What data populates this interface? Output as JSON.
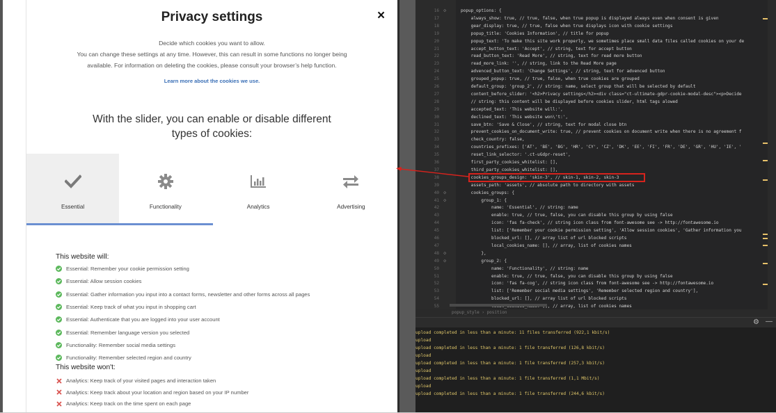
{
  "modal": {
    "title": "Privacy settings",
    "close_label": "×",
    "desc_line1": "Decide which cookies you want to allow.",
    "desc_line2": "You can change these settings at any time. However, this can result in some functions no longer being",
    "desc_line3": "available. For information on deleting the cookies, please consult your browser’s help function.",
    "learn_more": "Learn more about the cookies we use.",
    "slider_heading_line1": "With the slider, you can enable or disable different",
    "slider_heading_line2": "types of cookies:",
    "tiles": [
      {
        "label": "Essential",
        "icon": "check-icon",
        "active": true
      },
      {
        "label": "Functionality",
        "icon": "gear-icon",
        "active": false
      },
      {
        "label": "Analytics",
        "icon": "bar-chart-icon",
        "active": false
      },
      {
        "label": "Advertising",
        "icon": "exchange-arrows-icon",
        "active": false
      }
    ],
    "will_title": "This website will:",
    "will_items": [
      "Essential: Remember your cookie permission setting",
      "Essential: Allow session cookies",
      "Essential: Gather information you input into a contact forms, newsletter and other forms across all pages",
      "Essential: Keep track of what you input in shopping cart",
      "Essential: Authenticate that you are logged into your user account",
      "Essential: Remember language version you selected",
      "Functionality: Remember social media settings",
      "Functionality: Remember selected region and country"
    ],
    "wont_title": "This website won't:",
    "wont_items": [
      "Analytics: Keep track of your visited pages and interaction taken",
      "Analytics: Keep track about your location and region based on your IP number",
      "Analytics: Keep track on the time spent on each page"
    ],
    "colors": {
      "check": "#5cb85c",
      "cross": "#d9534f",
      "link": "#3a6fb6",
      "slider": "#6b8fd1"
    }
  },
  "editor": {
    "line_numbers": [
      "16",
      "17",
      "18",
      "19",
      "20",
      "21",
      "22",
      "23",
      "24",
      "25",
      "26",
      "27",
      "28",
      "29",
      "30",
      "31",
      "32",
      "33",
      "34",
      "35",
      "36",
      "37",
      "38",
      "39",
      "40",
      "41",
      "42",
      "43",
      "44",
      "45",
      "46",
      "47",
      "48",
      "49",
      "50",
      "51",
      "52",
      "53",
      "54",
      "55"
    ],
    "lines": [
      "popup_options: {",
      "    always_show: true, // true, false, when true popup is displayed always even when consent is given",
      "    gear_display: true, // true, false when true displays icon with cookie settings",
      "    popup_title: 'Cookies Information', // title for popup",
      "    popup_text: 'To make this site work properly, we sometimes place small data files called cookies on your de",
      "    accept_button_text: 'Accept', // string, text for accept button",
      "    read_button_text: 'Read More', // string, text for read more button",
      "    read_more_link: '', // string, link to the Read More page",
      "    advenced_button_text: 'Change Settings', // string, text for advenced button",
      "    grouped_popup: true, // true, false, when true cookies are grouped",
      "    default_group: 'group_2', // string: name, select group that will be selected by default",
      "    content_before_slider: '<h2>Privacy settings</h2><div class=\"ct-ultimate-gdpr-cookie-modal-desc\"><p>Decide",
      "    // string: this content will be displayed before cookies slider, html tags alowed",
      "    accepted_text: 'This website will:',",
      "    declined_text: 'This website won\\'t:',",
      "    save_btn: 'Save & Close', // string, text for modal close btn",
      "    prevent_cookies_on_document_write: true, // prevent cookies on document write when there is no agreement f",
      "    check_country: false,",
      "    countries_prefixes: ['AT', 'BE', 'BG', 'HR', 'CY', 'CZ', 'DK', 'EE', 'FI', 'FR', 'DE', 'GR', 'HU', 'IE', '",
      "    reset_link_selector: '.ct-uGdpr-reset',",
      "    first_party_cookies_whitelist: [],",
      "    third_party_cookies_whitelist: [],",
      "    cookies_groups_design: 'skin-3', // skin-1, skin-2, skin-3",
      "    assets_path: 'assets', // absolute path to directory with assets",
      "    cookies_groups: {",
      "        group_1: {",
      "            name: 'Essential', // string: name",
      "            enable: true, // true, false, you can disable this group by using false",
      "            icon: 'fas fa-check', // string icon class from font-awesome see -> http://fontawesome.io",
      "            list: ['Remember your cookie permission setting', 'Allow session cookies', 'Gather information you",
      "            blocked_url: [], // array list of url blocked scripts",
      "            local_cookies_name: [], // array, list of cookies names",
      "        },",
      "        group_2: {",
      "            name: 'Functionality', // string: name",
      "            enable: true, // true, false, you can disable this group by using false",
      "            icon: 'fas fa-cog', // string icon class from font-awesome see -> http://fontawesome.io",
      "            list: ['Remember social media settings', 'Remember selected region and country'],",
      "            blocked_url: [], // array list of url blocked scripts",
      "            local_cookies_name: [], // array, list of cookies names"
    ],
    "breadcrumb": "popup_style  ›  position",
    "highlight_color": "#d6231d"
  },
  "console": {
    "gear_icon": "⚙",
    "minimize": "—",
    "lines": [
      "upload completed in less than a minute: 11 files transferred (922,1 kbit/s)",
      "upload",
      "upload completed in less than a minute: 1 file transferred (126,8 kbit/s)",
      "upload",
      "upload completed in less than a minute: 1 file transferred (257,3 kbit/s)",
      "upload",
      "upload completed in less than a minute: 1 file transferred (1,1 Mbit/s)",
      "upload",
      "upload completed in less than a minute: 1 file transferred (244,6 kbit/s)"
    ]
  }
}
